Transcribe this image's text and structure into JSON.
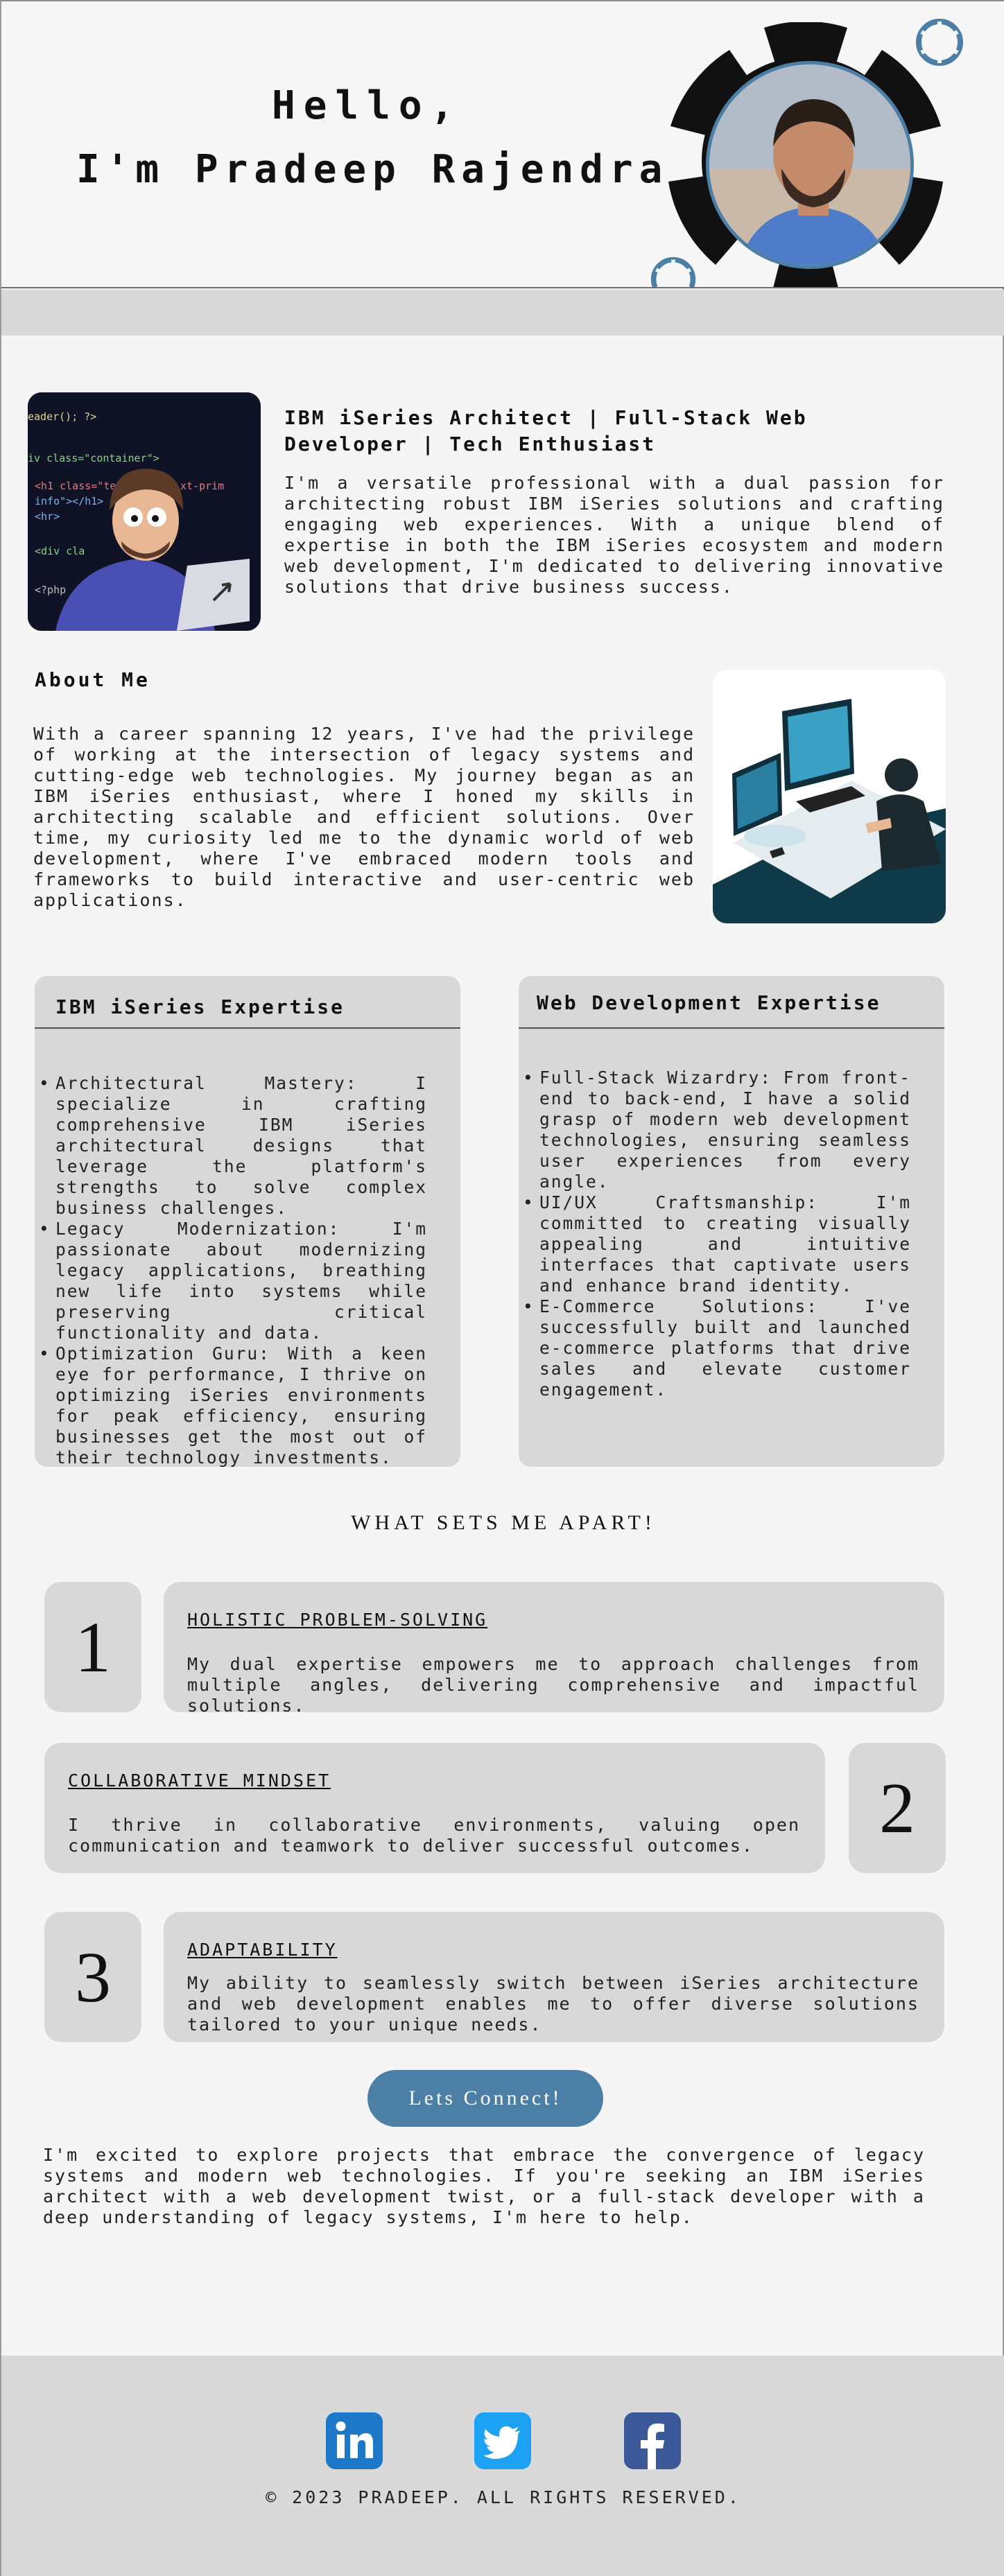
{
  "hero": {
    "greeting": "Hello,",
    "name": "I'm Pradeep Rajendra",
    "profile_photo": "profile-photo"
  },
  "intro": {
    "illustration": "developer-cartoon-illustration",
    "code_lines": [
      "eader(); ?>",
      "iv class=\"container\">",
      "<h1 class=\"te",
      "xt-prim",
      "info\"></h1> <",
      "<hr>",
      "<div cla",
      "<?php"
    ],
    "title": "IBM iSeries Architect | Full-Stack Web Developer | Tech Enthusiast",
    "text": "I'm a versatile professional with a dual passion for architecting robust IBM iSeries solutions and crafting engaging web experiences. With a unique blend of expertise in both the IBM iSeries ecosystem and modern web development, I'm dedicated to delivering innovative solutions that drive business success."
  },
  "about": {
    "title": "About Me",
    "text": "With a career spanning 12 years, I've had the privilege of working at the intersection of legacy systems and cutting-edge web technologies. My journey began as an IBM iSeries enthusiast, where I honed my skills in architecting scalable and efficient solutions. Over time, my curiosity led me to the dynamic world of web development, where I've embraced modern tools and frameworks to build interactive and user-centric web applications.",
    "illustration": "developer-at-desk-illustration"
  },
  "expertise": {
    "ibm": {
      "title": "IBM iSeries Expertise",
      "items": [
        "Architectural Mastery: I specialize in crafting comprehensive IBM iSeries architectural designs that leverage the platform's strengths to solve complex business challenges.",
        "Legacy Modernization: I'm passionate about modernizing legacy applications, breathing new life into systems while preserving critical functionality and data.",
        "Optimization Guru: With a keen eye for performance, I thrive on optimizing iSeries environments for peak efficiency, ensuring businesses get the most out of their technology investments."
      ]
    },
    "web": {
      "title": "Web Development Expertise",
      "items": [
        "Full-Stack Wizardry: From front-end to back-end, I have a solid grasp of modern web development technologies, ensuring seamless user experiences from every angle.",
        "UI/UX Craftsmanship: I'm committed to creating visually appealing and intuitive interfaces that captivate users and enhance brand identity.",
        "E-Commerce Solutions: I've successfully built and launched e-commerce platforms that drive sales and elevate customer engagement."
      ]
    }
  },
  "apart": {
    "title": "WHAT SETS ME APART!",
    "items": [
      {
        "number": "1",
        "title": "HOLISTIC PROBLEM-SOLVING",
        "text": "My dual expertise empowers me to approach challenges from multiple angles, delivering comprehensive and impactful solutions."
      },
      {
        "number": "2",
        "title": "COLLABORATIVE MINDSET",
        "text": "I thrive in collaborative environments, valuing open communication and teamwork to deliver successful outcomes."
      },
      {
        "number": "3",
        "title": "ADAPTABILITY",
        "text": "My ability to seamlessly switch between iSeries architecture and web development enables me to offer diverse solutions tailored to your unique needs."
      }
    ]
  },
  "cta": {
    "label": "Lets Connect!"
  },
  "closing": {
    "text": "I'm excited to explore projects that embrace the convergence of legacy systems and modern web technologies. If you're seeking an IBM iSeries architect with a web development twist, or a full-stack developer with a deep understanding of legacy systems, I'm here to help."
  },
  "footer": {
    "social": [
      {
        "name": "linkedin",
        "icon": "linkedin-icon",
        "color": "#1e78c8"
      },
      {
        "name": "twitter",
        "icon": "twitter-icon",
        "color": "#1da1f2"
      },
      {
        "name": "facebook",
        "icon": "facebook-icon",
        "color": "#3b5998"
      }
    ],
    "copyright": "© 2023 PRADEEP. ALL RIGHTS RESERVED."
  },
  "colors": {
    "accent": "#4c7fa6",
    "card_bg": "#d8d8d8",
    "band_bg": "#d9d9d9",
    "hero_ring": "#111111"
  }
}
